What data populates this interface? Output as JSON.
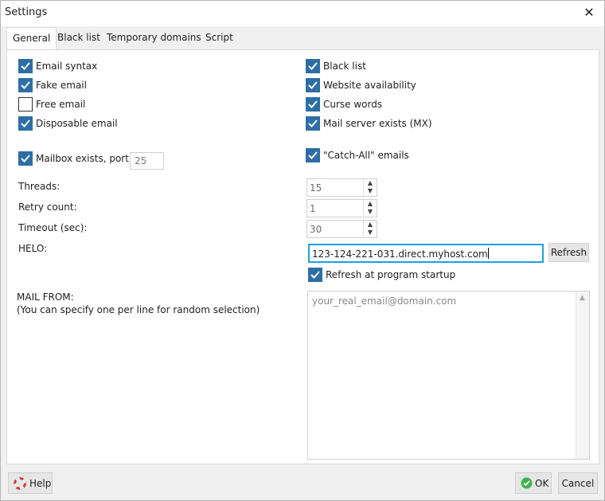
{
  "window": {
    "title": "Settings",
    "close_icon": "close-icon"
  },
  "tabs": [
    {
      "label": "General",
      "active": true
    },
    {
      "label": "Black list",
      "active": false
    },
    {
      "label": "Temporary domains",
      "active": false
    },
    {
      "label": "Script",
      "active": false
    }
  ],
  "left_checks": [
    {
      "label": "Email syntax",
      "checked": true
    },
    {
      "label": "Fake email",
      "checked": true
    },
    {
      "label": "Free email",
      "checked": false
    },
    {
      "label": "Disposable email",
      "checked": true
    }
  ],
  "right_checks": [
    {
      "label": "Black list",
      "checked": true
    },
    {
      "label": "Website availability",
      "checked": true
    },
    {
      "label": "Curse words",
      "checked": true
    },
    {
      "label": "Mail server exists (MX)",
      "checked": true
    }
  ],
  "mailbox": {
    "label": "Mailbox exists, port:",
    "checked": true,
    "port": "25"
  },
  "catch_all": {
    "label": "\"Catch-All\" emails",
    "checked": true
  },
  "threads": {
    "label": "Threads:",
    "value": "15"
  },
  "retry": {
    "label": "Retry count:",
    "value": "1"
  },
  "timeout": {
    "label": "Timeout (sec):",
    "value": "30"
  },
  "helo": {
    "label": "HELO:",
    "value": "123-124-221-031.direct.myhost.com",
    "refresh_button": "Refresh",
    "refresh_startup": {
      "label": "Refresh at program startup",
      "checked": true
    }
  },
  "mail_from": {
    "label": "MAIL FROM:",
    "hint": "(You can specify one per line for random selection)",
    "placeholder": "your_real_email@domain.com"
  },
  "footer": {
    "help": "Help",
    "ok": "OK",
    "cancel": "Cancel"
  },
  "colors": {
    "accent": "#2e6ea6",
    "focus": "#1ba1e2",
    "ok_green": "#3cb44b",
    "help_red": "#d9342b"
  }
}
